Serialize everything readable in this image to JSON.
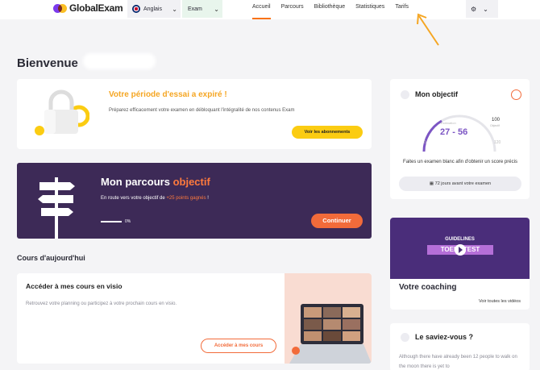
{
  "header": {
    "brand": "GlobalExam",
    "language": "Anglais",
    "exam": "Exam",
    "nav": [
      "Accueil",
      "Parcours",
      "Bibliothèque",
      "Statistiques",
      "Tarifs"
    ]
  },
  "welcome": "Bienvenue",
  "trial": {
    "title": "Votre période d'essai a expiré !",
    "desc": "Préparez efficacement votre examen en débloquant l'intégralité de nos contenus Exam",
    "button": "Voir les abonnements"
  },
  "parcours": {
    "title_a": "Mon parcours ",
    "title_b": "objectif",
    "sub_a": "En route vers votre objectif de ",
    "sub_b": "+25 points gagnés",
    "sub_c": " !",
    "progress": "0%",
    "button": "Continuer"
  },
  "cours": {
    "section_title": "Cours d'aujourd'hui",
    "title": "Accéder à mes cours en visio",
    "desc": "Retrouvez votre planning ou participez à votre prochain cours en visio.",
    "button": "Accéder à mes cours"
  },
  "objectif": {
    "title": "Mon objectif",
    "estimation": "Estimation",
    "score": "27 - 56",
    "target": "100",
    "target_label": "Objectif",
    "min": "0",
    "max": "120",
    "desc": "Faites un examen blanc afin d'obtenir un score précis",
    "days": "72 jours avant votre examen"
  },
  "coaching": {
    "guidelines": "GUIDELINES",
    "toefl": "TOEFL TEST",
    "title": "Votre coaching",
    "link": "Voir toutes les vidéos"
  },
  "saviez": {
    "title": "Le saviez-vous ?",
    "desc": "Although there have already been 12 people to walk on the moon there is yet to"
  },
  "colors": {
    "accent_orange": "#f26b3a",
    "trial_title": "#f5a623",
    "button_yellow": "#fbcc12",
    "parcours_bg": "#3d2a57",
    "purple": "#7c55c4"
  }
}
